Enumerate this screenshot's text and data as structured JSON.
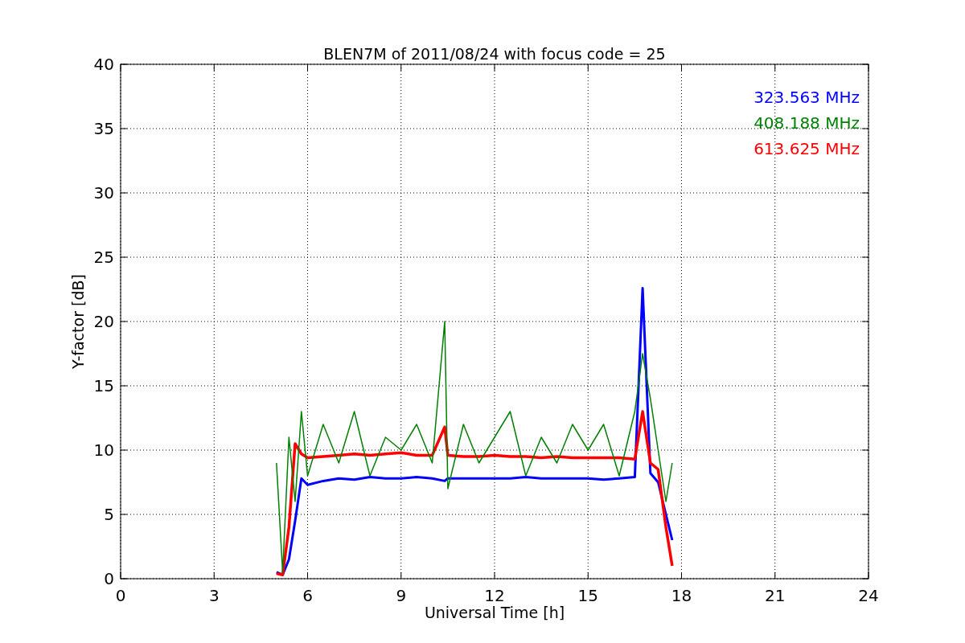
{
  "figure": {
    "chart_data": {
      "type": "line",
      "title": "BLEN7M of 2011/08/24 with focus code = 25",
      "xlabel": "Universal Time [h]",
      "ylabel": "Y-factor [dB]",
      "x": [
        5.0,
        5.2,
        5.4,
        5.6,
        5.8,
        6,
        6.5,
        7,
        7.5,
        8,
        8.5,
        9,
        9.5,
        10,
        10.4,
        10.5,
        11,
        11.5,
        12,
        12.5,
        13,
        13.5,
        14,
        14.5,
        15,
        15.5,
        16,
        16.5,
        16.75,
        17,
        17.25,
        17.5,
        17.7
      ],
      "series": [
        {
          "name": "323.563 MHz",
          "color": "#0000ff",
          "values": [
            0.5,
            0.3,
            1.5,
            4.5,
            7.8,
            7.3,
            7.6,
            7.8,
            7.7,
            7.9,
            7.8,
            7.8,
            7.9,
            7.8,
            7.6,
            7.8,
            7.8,
            7.8,
            7.8,
            7.8,
            7.9,
            7.8,
            7.8,
            7.8,
            7.8,
            7.7,
            7.8,
            7.9,
            22.6,
            8.2,
            7.5,
            5,
            3
          ]
        },
        {
          "name": "408.188 MHz",
          "color": "#008000",
          "values": [
            9,
            0.5,
            11,
            6,
            13,
            8,
            12,
            9,
            13,
            8,
            11,
            10,
            12,
            9,
            20,
            7,
            12,
            9,
            11,
            13,
            8,
            11,
            9,
            12,
            10,
            12,
            8,
            13,
            17.5,
            14,
            10,
            6,
            9
          ]
        },
        {
          "name": "613.625 MHz",
          "color": "#ff0000",
          "values": [
            0.4,
            0.3,
            4,
            10.5,
            9.7,
            9.4,
            9.5,
            9.6,
            9.7,
            9.6,
            9.7,
            9.8,
            9.6,
            9.6,
            11.8,
            9.6,
            9.5,
            9.5,
            9.6,
            9.5,
            9.5,
            9.4,
            9.5,
            9.4,
            9.4,
            9.4,
            9.4,
            9.3,
            13,
            9.0,
            8.5,
            4,
            1
          ]
        }
      ],
      "grid": true,
      "xlim": [
        0,
        24
      ],
      "ylim": [
        0,
        40
      ],
      "xticks": [
        0,
        3,
        6,
        9,
        12,
        15,
        18,
        21,
        24
      ],
      "yticks": [
        0,
        5,
        10,
        15,
        20,
        25,
        30,
        35,
        40
      ]
    }
  }
}
